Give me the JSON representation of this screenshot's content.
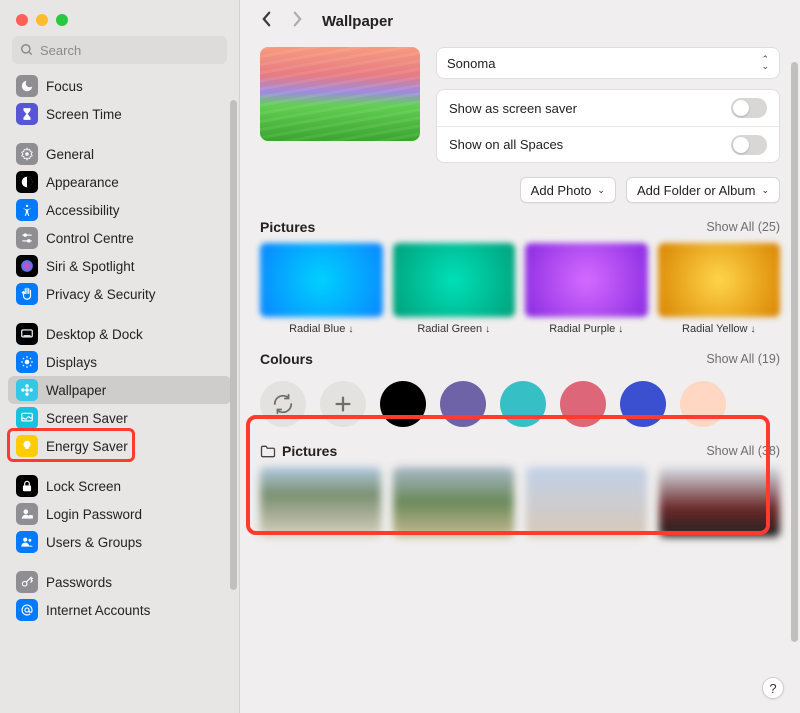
{
  "window": {
    "title": "Wallpaper",
    "search_placeholder": "Search"
  },
  "sidebar": {
    "items": [
      {
        "label": "Focus",
        "icon": "moon",
        "bg": "#8e8e93"
      },
      {
        "label": "Screen Time",
        "icon": "hourglass",
        "bg": "#5856d6"
      },
      {
        "spacer": true
      },
      {
        "label": "General",
        "icon": "gear",
        "bg": "#8e8e93"
      },
      {
        "label": "Appearance",
        "icon": "appearance",
        "bg": "#000000"
      },
      {
        "label": "Accessibility",
        "icon": "accessibility",
        "bg": "#007aff"
      },
      {
        "label": "Control Centre",
        "icon": "sliders",
        "bg": "#8e8e93"
      },
      {
        "label": "Siri & Spotlight",
        "icon": "siri",
        "bg": "#000000"
      },
      {
        "label": "Privacy & Security",
        "icon": "hand",
        "bg": "#007aff"
      },
      {
        "spacer": true
      },
      {
        "label": "Desktop & Dock",
        "icon": "dock",
        "bg": "#000000"
      },
      {
        "label": "Displays",
        "icon": "sun",
        "bg": "#007aff"
      },
      {
        "label": "Wallpaper",
        "icon": "flower",
        "bg": "#33c7e8",
        "selected": true
      },
      {
        "label": "Screen Saver",
        "icon": "screensaver",
        "bg": "#18c1de"
      },
      {
        "label": "Energy Saver",
        "icon": "bulb",
        "bg": "#ffcc00"
      },
      {
        "spacer": true
      },
      {
        "label": "Lock Screen",
        "icon": "lock",
        "bg": "#000000"
      },
      {
        "label": "Login Password",
        "icon": "user-lock",
        "bg": "#8e8e93"
      },
      {
        "label": "Users & Groups",
        "icon": "users",
        "bg": "#007aff"
      },
      {
        "spacer": true
      },
      {
        "label": "Passwords",
        "icon": "key",
        "bg": "#8e8e93"
      },
      {
        "label": "Internet Accounts",
        "icon": "at",
        "bg": "#007aff"
      }
    ]
  },
  "hero": {
    "wallpaper_name": "Sonoma",
    "show_screensaver_label": "Show as screen saver",
    "show_screensaver_on": false,
    "show_all_spaces_label": "Show on all Spaces",
    "show_all_spaces_on": false
  },
  "buttons": {
    "add_photo": "Add Photo",
    "add_folder": "Add Folder or Album"
  },
  "sections": {
    "pictures": {
      "title": "Pictures",
      "show_all": "Show All  (25)",
      "items": [
        {
          "label": "Radial Blue",
          "grad": "#0a86ff,#00d1ff"
        },
        {
          "label": "Radial Green",
          "grad": "#00a07a,#00e0b8"
        },
        {
          "label": "Radial Purple",
          "grad": "#8a2be2,#d46bff"
        },
        {
          "label": "Radial Yellow",
          "grad": "#d98400,#ffd54a"
        }
      ]
    },
    "colours": {
      "title": "Colours",
      "show_all": "Show All  (19)",
      "swatches": [
        "#000000",
        "#6d63a6",
        "#36c0c6",
        "#de6679",
        "#3a50d1",
        "#ffd7c2"
      ]
    },
    "pictures_folder": {
      "title": "Pictures",
      "show_all": "Show All  (38)"
    }
  },
  "help": "?"
}
